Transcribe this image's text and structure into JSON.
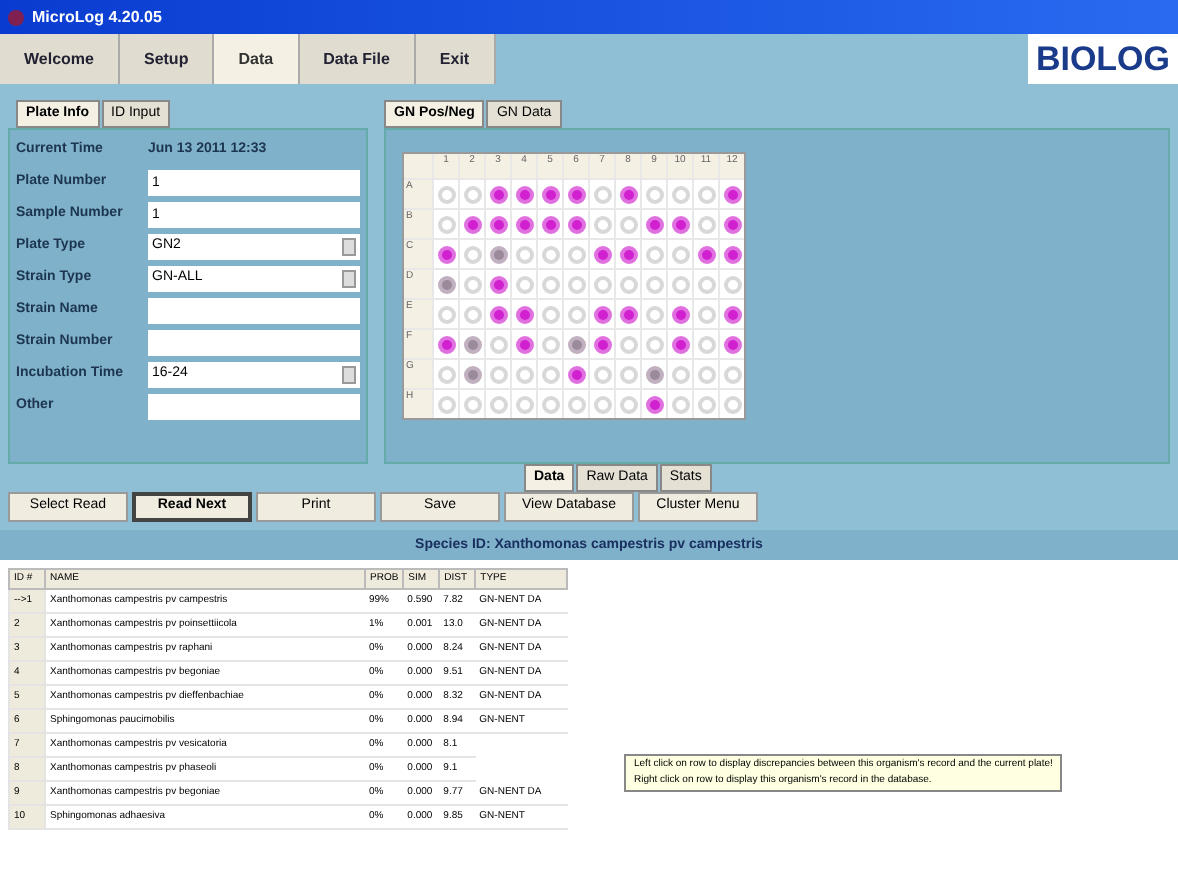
{
  "window": {
    "title": "MicroLog 4.20.05"
  },
  "menu_tabs": [
    {
      "label": "Welcome",
      "selected": false
    },
    {
      "label": "Setup",
      "selected": false
    },
    {
      "label": "Data",
      "selected": true
    },
    {
      "label": "Data File",
      "selected": false
    },
    {
      "label": "Exit",
      "selected": false
    }
  ],
  "logo": "BIOLOG",
  "left_tabs": [
    {
      "label": "Plate Info",
      "selected": true
    },
    {
      "label": "ID Input",
      "selected": false
    }
  ],
  "fields": [
    {
      "label": "Current Time",
      "kind": "text",
      "value": "Jun 13 2011 12:33"
    },
    {
      "label": "Plate Number",
      "kind": "input",
      "value": "1"
    },
    {
      "label": "Sample Number",
      "kind": "input",
      "value": "1"
    },
    {
      "label": "Plate Type",
      "kind": "select",
      "value": "GN2"
    },
    {
      "label": "Strain Type",
      "kind": "select",
      "value": "GN-ALL"
    },
    {
      "label": "Strain Name",
      "kind": "input"
    },
    {
      "label": "Strain Number",
      "kind": "input"
    },
    {
      "label": "Incubation Time",
      "kind": "select",
      "value": "16-24"
    },
    {
      "label": "Other",
      "kind": "input"
    }
  ],
  "right_tabs": [
    {
      "label": "GN Pos/Neg",
      "selected": true
    },
    {
      "label": "GN Data",
      "selected": false
    }
  ],
  "plate": {
    "columns": [
      "1",
      "2",
      "3",
      "4",
      "5",
      "6",
      "7",
      "8",
      "9",
      "10",
      "11",
      "12"
    ],
    "rows": [
      {
        "label": "A",
        "wells": [
          {
            "kind": "negative"
          },
          {
            "kind": "negative"
          },
          {
            "kind": "positive"
          },
          {
            "kind": "positive"
          },
          {
            "kind": "positive"
          },
          {
            "kind": "positive"
          },
          {
            "kind": "negative"
          },
          {
            "kind": "positive"
          },
          {
            "kind": "negative"
          },
          {
            "kind": "negative"
          },
          {
            "kind": "negative"
          },
          {
            "kind": "positive"
          }
        ]
      },
      {
        "label": "B",
        "wells": [
          {
            "kind": "negative"
          },
          {
            "kind": "positive"
          },
          {
            "kind": "positive"
          },
          {
            "kind": "positive"
          },
          {
            "kind": "positive"
          },
          {
            "kind": "positive"
          },
          {
            "kind": "negative"
          },
          {
            "kind": "negative"
          },
          {
            "kind": "positive"
          },
          {
            "kind": "positive"
          },
          {
            "kind": "negative"
          },
          {
            "kind": "positive"
          }
        ]
      },
      {
        "label": "C",
        "wells": [
          {
            "kind": "positive"
          },
          {
            "kind": "negative"
          },
          {
            "kind": "borderline"
          },
          {
            "kind": "negative"
          },
          {
            "kind": "negative"
          },
          {
            "kind": "negative"
          },
          {
            "kind": "positive"
          },
          {
            "kind": "positive"
          },
          {
            "kind": "negative"
          },
          {
            "kind": "negative"
          },
          {
            "kind": "positive"
          },
          {
            "kind": "positive"
          }
        ]
      },
      {
        "label": "D",
        "wells": [
          {
            "kind": "borderline"
          },
          {
            "kind": "negative"
          },
          {
            "kind": "positive"
          },
          {
            "kind": "negative"
          },
          {
            "kind": "negative"
          },
          {
            "kind": "negative"
          },
          {
            "kind": "negative"
          },
          {
            "kind": "negative"
          },
          {
            "kind": "negative"
          },
          {
            "kind": "negative"
          },
          {
            "kind": "negative"
          },
          {
            "kind": "negative"
          }
        ]
      },
      {
        "label": "E",
        "wells": [
          {
            "kind": "negative"
          },
          {
            "kind": "negative"
          },
          {
            "kind": "positive"
          },
          {
            "kind": "positive"
          },
          {
            "kind": "negative"
          },
          {
            "kind": "negative"
          },
          {
            "kind": "positive"
          },
          {
            "kind": "positive"
          },
          {
            "kind": "negative"
          },
          {
            "kind": "positive"
          },
          {
            "kind": "negative"
          },
          {
            "kind": "positive"
          }
        ]
      },
      {
        "label": "F",
        "wells": [
          {
            "kind": "positive"
          },
          {
            "kind": "borderline"
          },
          {
            "kind": "negative"
          },
          {
            "kind": "positive"
          },
          {
            "kind": "negative"
          },
          {
            "kind": "borderline"
          },
          {
            "kind": "positive"
          },
          {
            "kind": "negative"
          },
          {
            "kind": "negative"
          },
          {
            "kind": "positive"
          },
          {
            "kind": "negative"
          },
          {
            "kind": "positive"
          }
        ]
      },
      {
        "label": "G",
        "wells": [
          {
            "kind": "negative"
          },
          {
            "kind": "borderline"
          },
          {
            "kind": "negative"
          },
          {
            "kind": "negative"
          },
          {
            "kind": "negative"
          },
          {
            "kind": "positive"
          },
          {
            "kind": "negative"
          },
          {
            "kind": "negative"
          },
          {
            "kind": "borderline"
          },
          {
            "kind": "negative"
          },
          {
            "kind": "negative"
          },
          {
            "kind": "negative"
          }
        ]
      },
      {
        "label": "H",
        "wells": [
          {
            "kind": "negative"
          },
          {
            "kind": "negative"
          },
          {
            "kind": "negative"
          },
          {
            "kind": "negative"
          },
          {
            "kind": "negative"
          },
          {
            "kind": "negative"
          },
          {
            "kind": "negative"
          },
          {
            "kind": "negative"
          },
          {
            "kind": "positive"
          },
          {
            "kind": "negative"
          },
          {
            "kind": "negative"
          },
          {
            "kind": "negative"
          }
        ]
      }
    ]
  },
  "result_tabs": [
    {
      "label": "Data",
      "selected": true
    },
    {
      "label": "Raw Data",
      "selected": false
    },
    {
      "label": "Stats",
      "selected": false
    }
  ],
  "buttons": [
    {
      "label": "Select Read",
      "default": false
    },
    {
      "label": "Read Next",
      "default": true
    },
    {
      "label": "Print",
      "default": false
    },
    {
      "label": "Save",
      "default": false
    },
    {
      "label": "View Database",
      "default": false
    },
    {
      "label": "Cluster Menu",
      "default": false
    }
  ],
  "species_banner": "Species ID: Xanthomonas campestris pv campestris",
  "table": {
    "columns": [
      "ID #",
      "NAME",
      "PROB",
      "SIM",
      "DIST",
      "TYPE"
    ],
    "rows": [
      [
        "-->1",
        "Xanthomonas campestris pv campestris",
        "99%",
        "0.590",
        "7.82",
        "GN-NENT DA"
      ],
      [
        "2",
        "Xanthomonas campestris pv poinsettiicola",
        "1%",
        "0.001",
        "13.0",
        "GN-NENT DA"
      ],
      [
        "3",
        "Xanthomonas campestris pv raphani",
        "0%",
        "0.000",
        "8.24",
        "GN-NENT DA"
      ],
      [
        "4",
        "Xanthomonas campestris pv begoniae",
        "0%",
        "0.000",
        "9.51",
        "GN-NENT DA"
      ],
      [
        "5",
        "Xanthomonas campestris pv dieffenbachiae",
        "0%",
        "0.000",
        "8.32",
        "GN-NENT DA"
      ],
      [
        "6",
        "Sphingomonas paucimobilis",
        "0%",
        "0.000",
        "8.94",
        "GN-NENT"
      ],
      [
        "7",
        "Xanthomonas campestris pv vesicatoria",
        "0%",
        "0.000",
        "8.1"
      ],
      [
        "8",
        "Xanthomonas campestris pv phaseoli",
        "0%",
        "0.000",
        "9.1"
      ],
      [
        "9",
        "Xanthomonas campestris pv begoniae",
        "0%",
        "0.000",
        "9.77",
        "GN-NENT DA"
      ],
      [
        "10",
        "Sphingomonas adhaesiva",
        "0%",
        "0.000",
        "9.85",
        "GN-NENT"
      ]
    ]
  },
  "tooltip": [
    "Left click on row to display discrepancies between this organism's record and the current plate!",
    "Right click on row to display this organism's record in the database."
  ]
}
